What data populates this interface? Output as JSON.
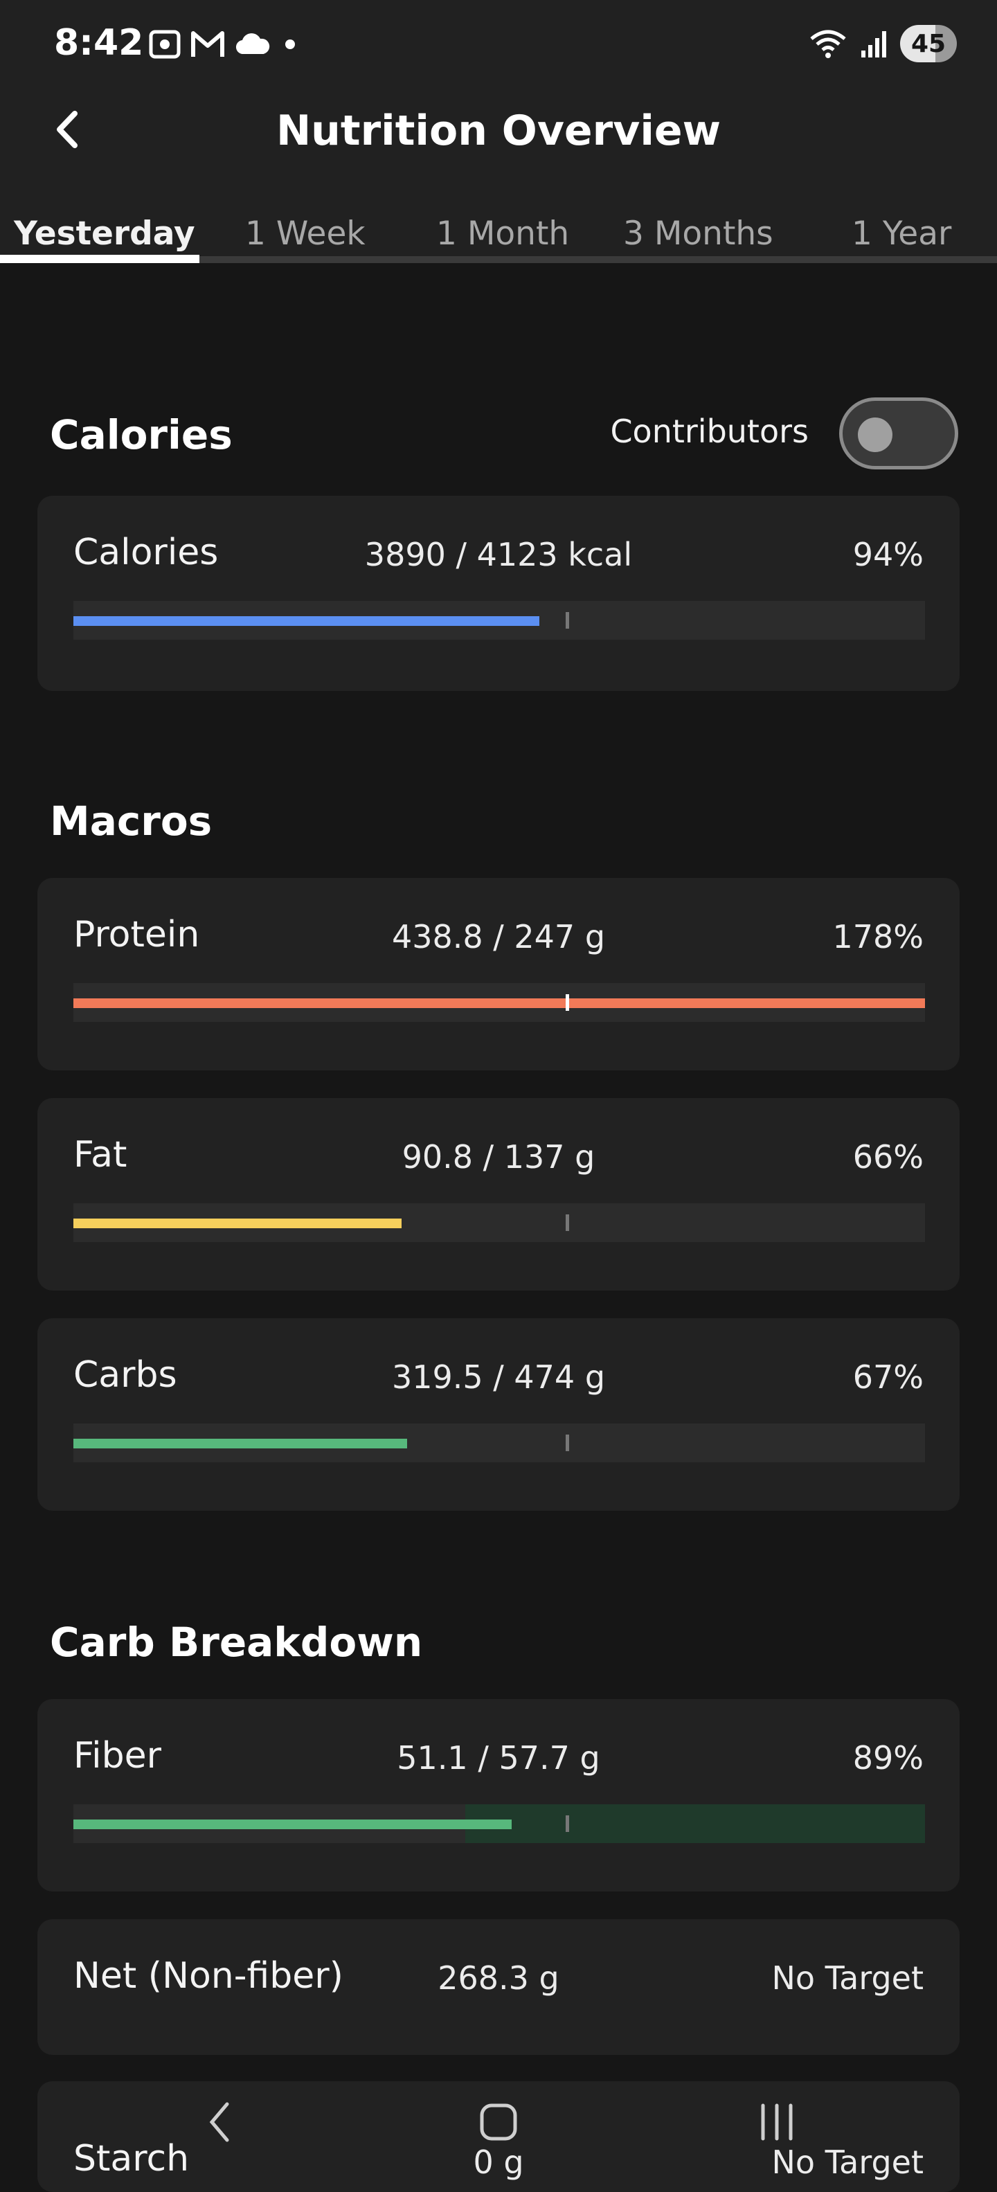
{
  "status": {
    "time": "8:42",
    "battery": "45"
  },
  "header": {
    "title": "Nutrition Overview"
  },
  "tabs": [
    "Yesterday",
    "1 Week",
    "1 Month",
    "3 Months",
    "1 Year"
  ],
  "sections": {
    "calories": "Calories",
    "macros": "Macros",
    "carb_breakdown": "Carb Breakdown"
  },
  "contributors_label": "Contributors",
  "cards": [
    {
      "label": "Calories",
      "value": "3890 / 4123 kcal",
      "pct": "94%",
      "fill": 0.547,
      "target": 0.58,
      "color": "#5b8ff2"
    },
    {
      "label": "Protein",
      "value": "438.8 / 247 g",
      "pct": "178%",
      "fill": 1.0,
      "target": 0.58,
      "color": "#f27a58"
    },
    {
      "label": "Fat",
      "value": "90.8 / 137 g",
      "pct": "66%",
      "fill": 0.385,
      "target": 0.58,
      "color": "#f5cf5c"
    },
    {
      "label": "Carbs",
      "value": "319.5 / 474 g",
      "pct": "67%",
      "fill": 0.392,
      "target": 0.58,
      "color": "#57b87c"
    },
    {
      "label": "Fiber",
      "value": "51.1 / 57.7 g",
      "pct": "89%",
      "fill": 0.515,
      "target": 0.58,
      "color": "#57b87c"
    },
    {
      "label": "Net (Non-fiber)",
      "value": "268.3 g",
      "pct": "No Target"
    },
    {
      "label": "Starch",
      "value": "0 g",
      "pct": "No Target"
    }
  ],
  "colors": {
    "accent_blue": "#5b8ff2",
    "protein": "#f27a58",
    "fat": "#f5cf5c",
    "carbs": "#57b87c",
    "background": "#161616",
    "card": "#222222"
  },
  "icons": [
    "back-arrow-icon",
    "screenshot-icon",
    "gmail-icon",
    "cloud-icon",
    "wifi-icon",
    "signal-icon",
    "nav-back-icon",
    "nav-home-icon",
    "nav-recents-icon"
  ]
}
